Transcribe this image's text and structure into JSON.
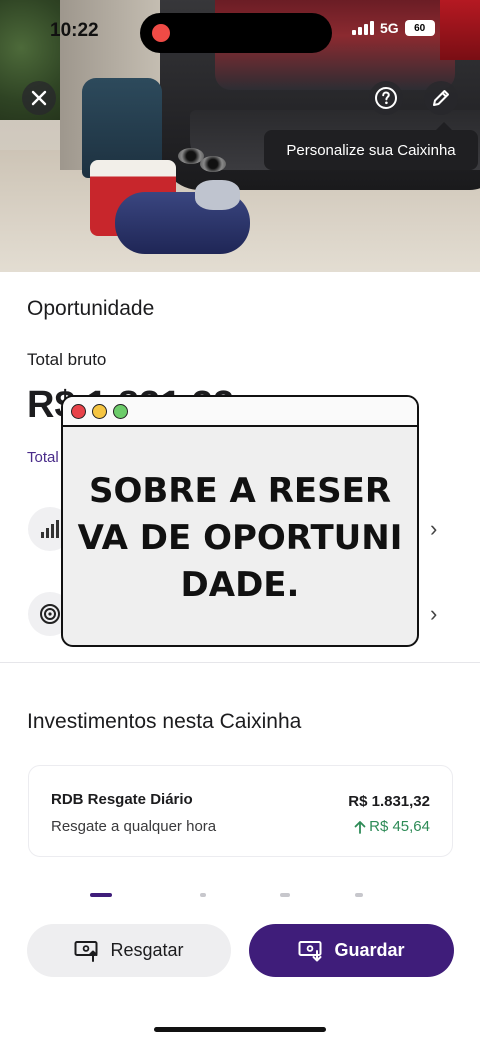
{
  "status_bar": {
    "time": "10:22",
    "network": "5G",
    "battery": "60",
    "recording_color": "#ef4b46"
  },
  "hero": {
    "close_icon": "close-icon",
    "help_icon": "help-circle-icon",
    "edit_icon": "pencil-icon",
    "tooltip": "Personalize sua Caixinha"
  },
  "summary": {
    "title": "Oportunidade",
    "total_label": "Total bruto",
    "total_value": "R$ 1.831,32",
    "total_link": "Total"
  },
  "rows": [
    {
      "icon": "chart-bars-icon"
    },
    {
      "icon": "target-icon"
    }
  ],
  "investments": {
    "title": "Investimentos nesta Caixinha",
    "items": [
      {
        "name": "RDB Resgate Diário",
        "subtitle": "Resgate a qualquer hora",
        "value": "R$ 1.831,32",
        "gain": "R$ 45,64",
        "gain_color": "#2e8b57"
      }
    ]
  },
  "actions": {
    "withdraw_label": "Resgatar",
    "deposit_label": "Guardar",
    "brand_color": "#3f1d7a"
  },
  "overlay": {
    "text": "SOBRE A RESERVA DE OPORTUNIDADE.",
    "dot_colors": [
      "#e8434a",
      "#f5c542",
      "#6ccc6a"
    ]
  }
}
